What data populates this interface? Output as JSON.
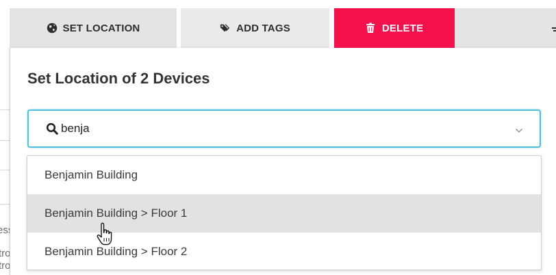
{
  "toolbar": {
    "set_location_label": "SET LOCATION",
    "add_tags_label": "ADD TAGS",
    "delete_label": "DELETE"
  },
  "modal": {
    "title": "Set Location of 2 Devices",
    "search": {
      "value": "benja",
      "icon": "search-icon"
    },
    "options": [
      {
        "label": "Benjamin Building",
        "highlighted": false
      },
      {
        "label": "Benjamin Building > Floor 1",
        "highlighted": true
      },
      {
        "label": "Benjamin Building > Floor 2",
        "highlighted": false
      }
    ]
  },
  "background": {
    "fragments": [
      "ess",
      "trol",
      "trol",
      "EI"
    ]
  },
  "colors": {
    "delete_bg": "#f5124c",
    "focus_border": "#4cc1de",
    "toolbar_bg": "#e4e4e4",
    "highlight_bg": "#e2e2e2"
  }
}
